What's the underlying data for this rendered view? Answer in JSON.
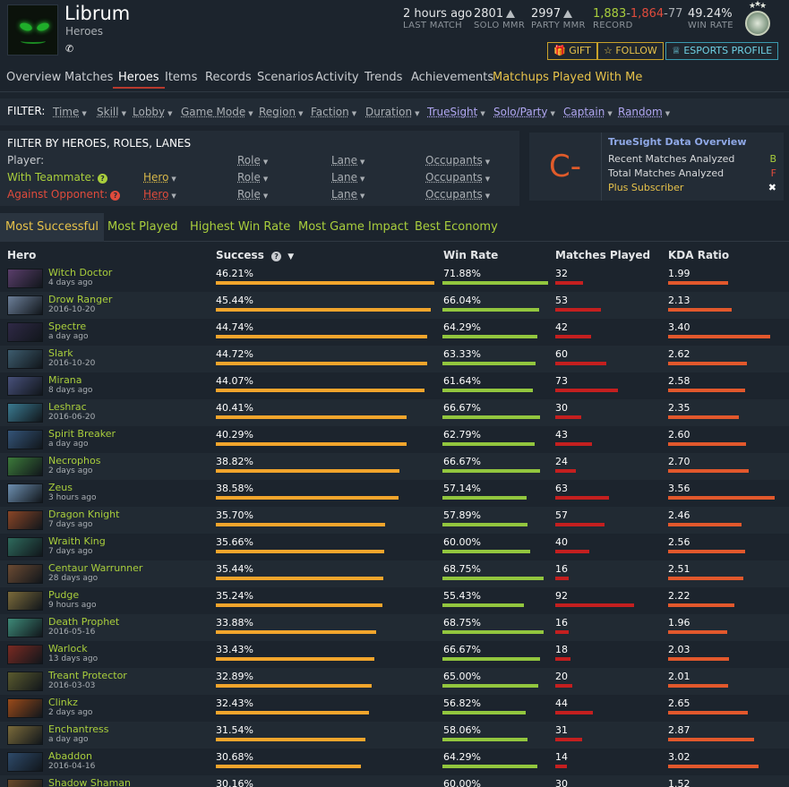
{
  "player": {
    "name": "Librum",
    "subtitle": "Heroes",
    "phone_icon": "✆"
  },
  "stats": {
    "last_match": {
      "value": "2 hours ago",
      "label": "LAST MATCH"
    },
    "solo_mmr": {
      "value": "2801",
      "label": "SOLO MMR"
    },
    "party_mmr": {
      "value": "2997",
      "label": "PARTY MMR"
    },
    "record": {
      "wins": "1,883",
      "losses": "1,864",
      "abandons": "77",
      "sep": "-",
      "label": "RECORD"
    },
    "win_rate": {
      "value": "49.24%",
      "label": "WIN RATE"
    }
  },
  "buttons": {
    "gift": "GIFT",
    "follow": "FOLLOW",
    "esports": "ESPORTS PROFILE"
  },
  "icons": {
    "gift": "gift-icon",
    "follow": "star-icon",
    "esports": "trophy-icon",
    "warning": "warning-icon",
    "help": "help-icon",
    "sort": "sort-desc-icon",
    "close": "close-icon"
  },
  "nav": {
    "tabs": [
      "Overview",
      "Matches",
      "Heroes",
      "Items",
      "Records",
      "Scenarios",
      "Activity",
      "Trends",
      "Achievements",
      "Matchups",
      "Played With Me"
    ],
    "active": "Heroes"
  },
  "filter": {
    "label": "FILTER:",
    "items": [
      "Time",
      "Skill",
      "Lobby",
      "Game Mode",
      "Region",
      "Faction",
      "Duration",
      "TrueSight",
      "Solo/Party",
      "Captain",
      "Random"
    ]
  },
  "hero_filter": {
    "title": "FILTER BY HEROES, ROLES, LANES",
    "player_label": "Player:",
    "teammate_label": "With Teammate:",
    "opponent_label": "Against Opponent:",
    "hero": "Hero",
    "role": "Role",
    "lane": "Lane",
    "occupants": "Occupants"
  },
  "truesight": {
    "grade": "C-",
    "title": "TrueSight Data Overview",
    "recent_label": "Recent Matches Analyzed",
    "recent_grade": "B",
    "total_label": "Total Matches Analyzed",
    "total_grade": "F",
    "plus_label": "Plus Subscriber",
    "close_glyph": "✖"
  },
  "subtabs": {
    "items": [
      "Most Successful",
      "Most Played",
      "Highest Win Rate",
      "Most Game Impact",
      "Best Economy"
    ],
    "active": "Most Successful"
  },
  "table": {
    "columns": {
      "hero": "Hero",
      "success": "Success",
      "win_rate": "Win Rate",
      "matches": "Matches Played",
      "kda": "KDA Ratio"
    },
    "rows": [
      {
        "hero": "Witch Doctor",
        "when": "4 days ago",
        "success": "46.21%",
        "win_rate": "71.88%",
        "matches": "32",
        "kda": "1.99",
        "color": "#5a3e6b"
      },
      {
        "hero": "Drow Ranger",
        "when": "2016-10-20",
        "success": "45.44%",
        "win_rate": "66.04%",
        "matches": "53",
        "kda": "2.13",
        "color": "#6c7f99"
      },
      {
        "hero": "Spectre",
        "when": "a day ago",
        "success": "44.74%",
        "win_rate": "64.29%",
        "matches": "42",
        "kda": "3.40",
        "color": "#2f2946"
      },
      {
        "hero": "Slark",
        "when": "2016-10-20",
        "success": "44.72%",
        "win_rate": "63.33%",
        "matches": "60",
        "kda": "2.62",
        "color": "#3d5c6e"
      },
      {
        "hero": "Mirana",
        "when": "8 days ago",
        "success": "44.07%",
        "win_rate": "61.64%",
        "matches": "73",
        "kda": "2.58",
        "color": "#47507a"
      },
      {
        "hero": "Leshrac",
        "when": "2016-06-20",
        "success": "40.41%",
        "win_rate": "66.67%",
        "matches": "30",
        "kda": "2.35",
        "color": "#3a7a90"
      },
      {
        "hero": "Spirit Breaker",
        "when": "a day ago",
        "success": "40.29%",
        "win_rate": "62.79%",
        "matches": "43",
        "kda": "2.60",
        "color": "#345478"
      },
      {
        "hero": "Necrophos",
        "when": "2 days ago",
        "success": "38.82%",
        "win_rate": "66.67%",
        "matches": "24",
        "kda": "2.70",
        "color": "#3c7a3a"
      },
      {
        "hero": "Zeus",
        "when": "3 hours ago",
        "success": "38.58%",
        "win_rate": "57.14%",
        "matches": "63",
        "kda": "3.56",
        "color": "#6d8fb0"
      },
      {
        "hero": "Dragon Knight",
        "when": "7 days ago",
        "success": "35.70%",
        "win_rate": "57.89%",
        "matches": "57",
        "kda": "2.46",
        "color": "#8a4526"
      },
      {
        "hero": "Wraith King",
        "when": "7 days ago",
        "success": "35.66%",
        "win_rate": "60.00%",
        "matches": "40",
        "kda": "2.56",
        "color": "#2e6a5c"
      },
      {
        "hero": "Centaur Warrunner",
        "when": "28 days ago",
        "success": "35.44%",
        "win_rate": "68.75%",
        "matches": "16",
        "kda": "2.51",
        "color": "#6b4a32"
      },
      {
        "hero": "Pudge",
        "when": "9 hours ago",
        "success": "35.24%",
        "win_rate": "55.43%",
        "matches": "92",
        "kda": "2.22",
        "color": "#7b6a3a"
      },
      {
        "hero": "Death Prophet",
        "when": "2016-05-16",
        "success": "33.88%",
        "win_rate": "68.75%",
        "matches": "16",
        "kda": "1.96",
        "color": "#3e8a78"
      },
      {
        "hero": "Warlock",
        "when": "13 days ago",
        "success": "33.43%",
        "win_rate": "66.67%",
        "matches": "18",
        "kda": "2.03",
        "color": "#7a2a22"
      },
      {
        "hero": "Treant Protector",
        "when": "2016-03-03",
        "success": "32.89%",
        "win_rate": "65.00%",
        "matches": "20",
        "kda": "2.01",
        "color": "#5a5a2e"
      },
      {
        "hero": "Clinkz",
        "when": "2 days ago",
        "success": "32.43%",
        "win_rate": "56.82%",
        "matches": "44",
        "kda": "2.65",
        "color": "#9a4a1a"
      },
      {
        "hero": "Enchantress",
        "when": "a day ago",
        "success": "31.54%",
        "win_rate": "58.06%",
        "matches": "31",
        "kda": "2.87",
        "color": "#7a6a3a"
      },
      {
        "hero": "Abaddon",
        "when": "2016-04-16",
        "success": "30.68%",
        "win_rate": "64.29%",
        "matches": "14",
        "kda": "3.02",
        "color": "#2e4a6a"
      },
      {
        "hero": "Shadow Shaman",
        "when": "",
        "success": "30.16%",
        "win_rate": "60.00%",
        "matches": "30",
        "kda": "1.52",
        "color": "#6a4a2a"
      }
    ]
  }
}
